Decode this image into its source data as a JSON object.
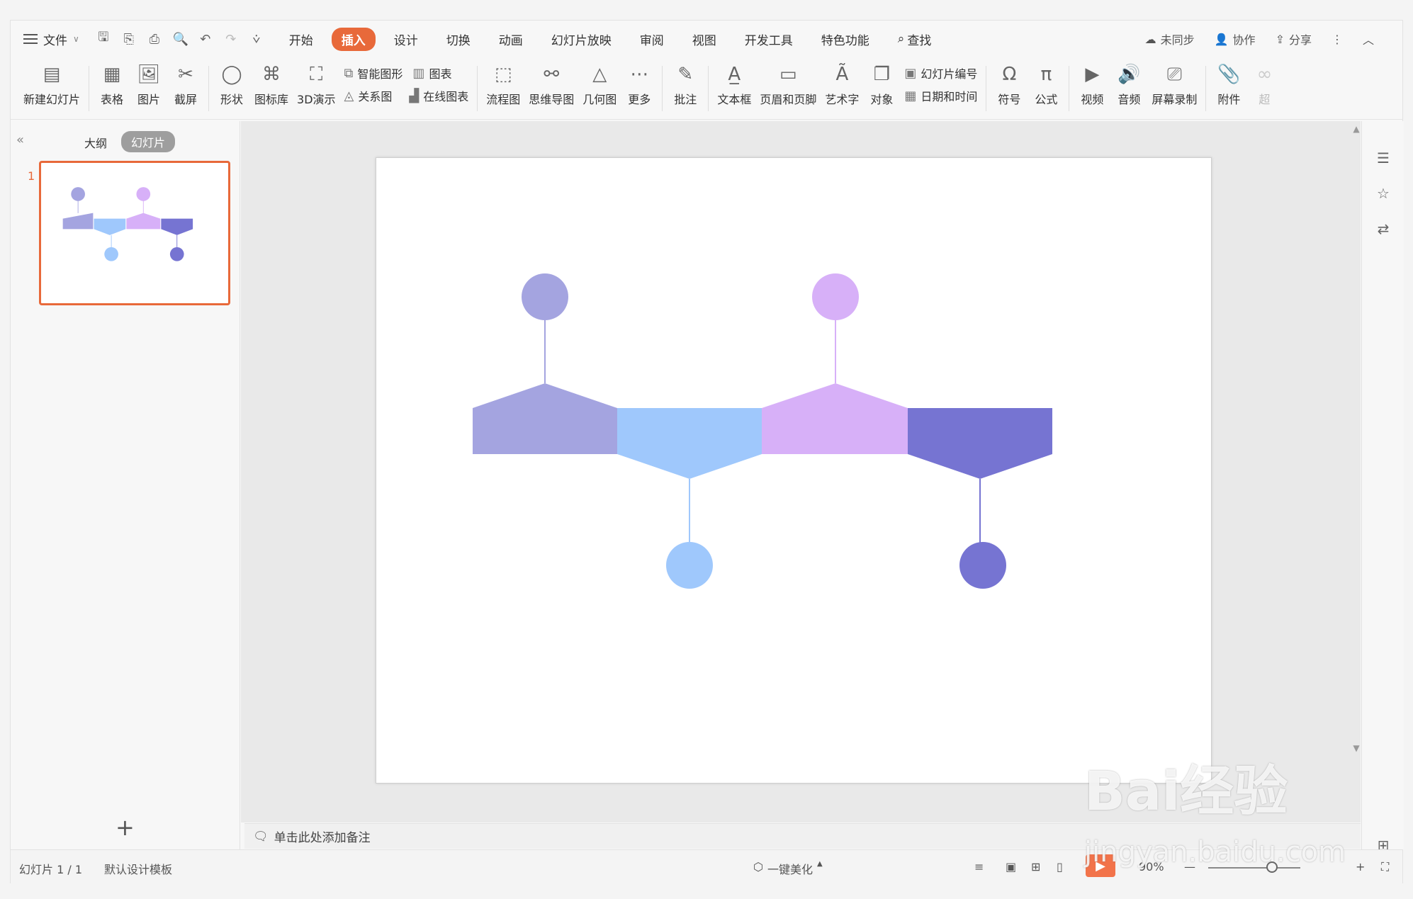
{
  "menu": {
    "file_label": "文件",
    "tabs": [
      {
        "label": "开始",
        "active": false
      },
      {
        "label": "插入",
        "active": true
      },
      {
        "label": "设计",
        "active": false
      },
      {
        "label": "切换",
        "active": false
      },
      {
        "label": "动画",
        "active": false
      },
      {
        "label": "幻灯片放映",
        "active": false
      },
      {
        "label": "审阅",
        "active": false
      },
      {
        "label": "视图",
        "active": false
      },
      {
        "label": "开发工具",
        "active": false
      },
      {
        "label": "特色功能",
        "active": false
      }
    ],
    "search_label": "查找",
    "sync_label": "未同步",
    "collab_label": "协作",
    "share_label": "分享"
  },
  "ribbon": {
    "new_slide": "新建幻灯片",
    "table": "表格",
    "picture": "图片",
    "screenshot": "截屏",
    "shape": "形状",
    "icon_lib": "图标库",
    "demo3d": "3D演示",
    "smart_art": "智能图形",
    "chart": "图表",
    "relation": "关系图",
    "online_chart": "在线图表",
    "flowchart": "流程图",
    "mindmap": "思维导图",
    "geometry": "几何图",
    "more": "更多",
    "comment": "批注",
    "textbox": "文本框",
    "header_footer": "页眉和页脚",
    "wordart": "艺术字",
    "object": "对象",
    "slide_number": "幻灯片编号",
    "date_time": "日期和时间",
    "symbol": "符号",
    "formula": "公式",
    "video": "视频",
    "audio": "音频",
    "screen_record": "屏幕录制",
    "attachment": "附件",
    "overflow": "超"
  },
  "left_panel": {
    "tab_outline": "大纲",
    "tab_slides": "幻灯片",
    "slide_number": "1"
  },
  "notes_placeholder": "单击此处添加备注",
  "status": {
    "slide_info": "幻灯片 1 / 1",
    "template": "默认设计模板",
    "beautify": "一键美化",
    "zoom": "90%"
  },
  "watermark": {
    "brand": "Bai经验",
    "url": "jingyan.baidu.com"
  },
  "colors": {
    "accent": "#e8693a",
    "shape1": "#a4a4e0",
    "shape2": "#9fc8fc",
    "shape3": "#d7b0f8",
    "shape4": "#7674d2"
  }
}
